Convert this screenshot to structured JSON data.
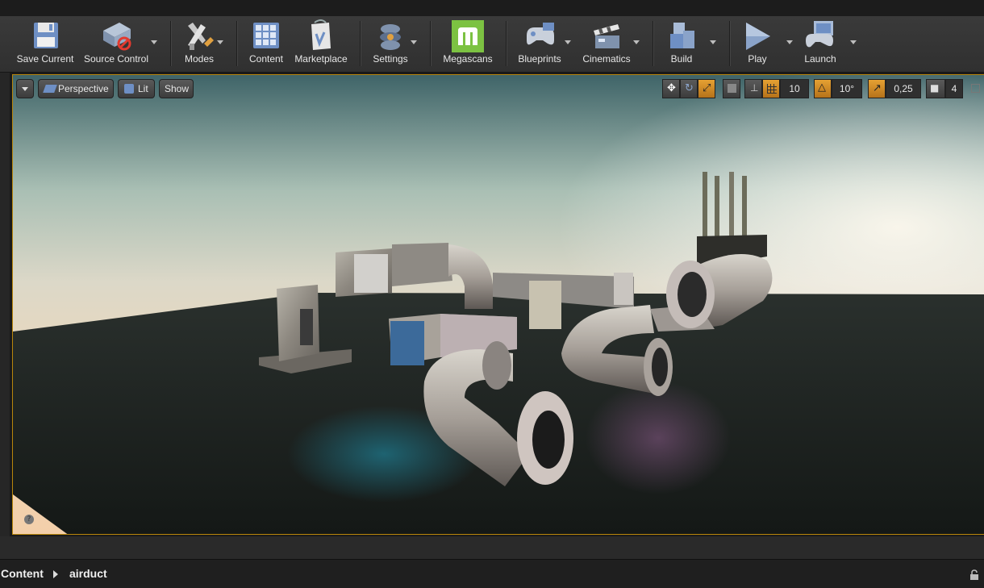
{
  "toolbar": {
    "save_current": "Save Current",
    "source_control": "Source Control",
    "modes": "Modes",
    "content": "Content",
    "marketplace": "Marketplace",
    "settings": "Settings",
    "megascans": "Megascans",
    "blueprints": "Blueprints",
    "cinematics": "Cinematics",
    "build": "Build",
    "play": "Play",
    "launch": "Launch"
  },
  "viewport": {
    "view_mode": "Perspective",
    "lighting": "Lit",
    "show": "Show",
    "grid_snap": "10",
    "rotation_snap": "10°",
    "scale_snap": "0,25",
    "camera_speed": "4",
    "help": "?"
  },
  "breadcrumb": {
    "root": "Content",
    "folder": "airduct"
  },
  "colors": {
    "accent": "#e6a133",
    "viewport_border": "#b8860b",
    "megascans": "#7cc242"
  },
  "icons": [
    "save-icon",
    "source-control-icon",
    "modes-icon",
    "content-icon",
    "marketplace-icon",
    "settings-icon",
    "megascans-icon",
    "blueprints-icon",
    "cinematics-icon",
    "build-icon",
    "play-icon",
    "launch-icon",
    "lock-icon"
  ]
}
